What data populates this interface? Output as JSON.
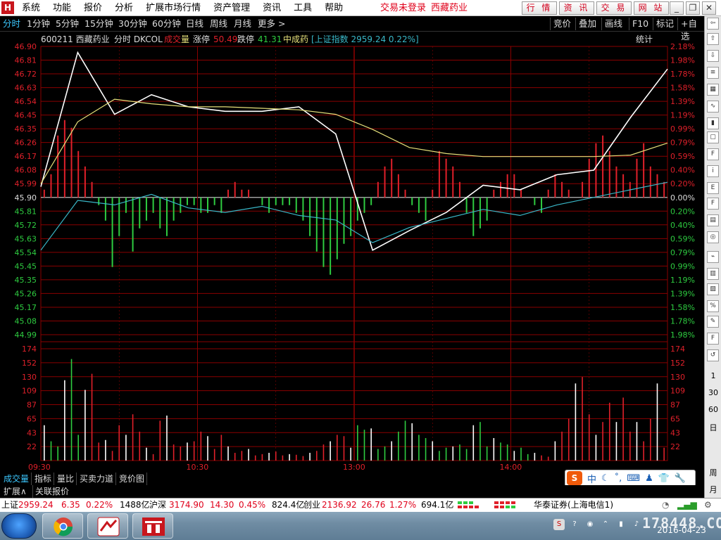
{
  "menu": {
    "items": [
      "系统",
      "功能",
      "报价",
      "分析",
      "扩展市场行情",
      "资产管理",
      "资讯",
      "工具",
      "帮助"
    ],
    "trade_status": "交易未登录",
    "stock_title": "西藏药业",
    "quick_buttons": [
      "行 情",
      "资 讯",
      "交 易",
      "网 站"
    ],
    "window_controls": [
      "_",
      "❐",
      "✕"
    ]
  },
  "tabs": {
    "periods": [
      "分时",
      "1分钟",
      "5分钟",
      "15分钟",
      "30分钟",
      "60分钟",
      "日线",
      "周线",
      "月线",
      "更多 >"
    ],
    "right": [
      "竞价",
      "叠加",
      "画线",
      "F10",
      "标记",
      "+自选"
    ]
  },
  "legend": {
    "code_name": "600211 西藏药业",
    "indicator": "分时 DKCOL",
    "vol_label_a": "成交",
    "vol_label_b": "量",
    "limit_up_label": "涨停",
    "limit_up": "50.49",
    "limit_down_label": "跌停",
    "limit_down": "41.31",
    "sector": "中成药",
    "index_info": "[上证指数 2959.24 0.22%]",
    "stats": "统计"
  },
  "colors": {
    "up": "#e0202a",
    "down": "#2ecc40",
    "price_line": "#ffffff",
    "avg_line": "#e6e07a",
    "index_line": "#39b8c8",
    "grid": "#8a0000"
  },
  "chart_data": [
    {
      "type": "line",
      "title": "分时",
      "x": [
        "09:30",
        "09:45",
        "10:00",
        "10:15",
        "10:30",
        "10:45",
        "11:00",
        "11:15",
        "11:30",
        "13:00",
        "13:15",
        "13:30",
        "13:45",
        "14:00",
        "14:15",
        "14:30",
        "14:45",
        "15:00"
      ],
      "xlabels": [
        "09:30",
        "10:30",
        "13:00",
        "14:00"
      ],
      "ylim": [
        44.99,
        46.9
      ],
      "yticks": [
        "46.90",
        "46.81",
        "46.72",
        "46.63",
        "46.54",
        "46.45",
        "46.35",
        "46.26",
        "46.17",
        "46.08",
        "45.99",
        "45.90",
        "45.81",
        "45.72",
        "45.63",
        "45.54",
        "45.45",
        "45.35",
        "45.26",
        "45.17",
        "45.08",
        "44.99"
      ],
      "pct_ticks": [
        "2.18%",
        "1.98%",
        "1.78%",
        "1.58%",
        "1.39%",
        "1.19%",
        "0.99%",
        "0.79%",
        "0.59%",
        "0.40%",
        "0.20%",
        "0.00%",
        "0.20%",
        "0.40%",
        "0.59%",
        "0.79%",
        "0.99%",
        "1.19%",
        "1.39%",
        "1.58%",
        "1.78%",
        "1.98%"
      ],
      "series": [
        {
          "name": "price",
          "values": [
            45.97,
            46.86,
            46.45,
            46.58,
            46.5,
            46.47,
            46.47,
            46.5,
            46.32,
            45.55,
            45.68,
            45.8,
            45.98,
            45.95,
            46.05,
            46.08,
            46.43,
            46.75
          ]
        },
        {
          "name": "average",
          "values": [
            45.99,
            46.4,
            46.55,
            46.52,
            46.5,
            46.5,
            46.49,
            46.48,
            46.45,
            46.35,
            46.23,
            46.19,
            46.17,
            46.17,
            46.17,
            46.17,
            46.18,
            46.26
          ]
        },
        {
          "name": "index",
          "values": [
            45.55,
            45.88,
            45.85,
            45.92,
            45.83,
            45.8,
            45.84,
            45.78,
            45.75,
            45.6,
            45.7,
            45.76,
            45.82,
            45.78,
            45.85,
            45.9,
            45.95,
            46.0
          ]
        }
      ]
    },
    {
      "type": "bar",
      "title": "成交量",
      "ylim": [
        0,
        174
      ],
      "yticks": [
        "174",
        "152",
        "130",
        "109",
        "87",
        "65",
        "43",
        "22"
      ],
      "values": [
        55,
        30,
        22,
        125,
        158,
        40,
        110,
        135,
        28,
        32,
        15,
        55,
        40,
        72,
        45,
        20,
        10,
        62,
        70,
        25,
        22,
        28,
        30,
        45,
        38,
        18,
        40,
        22,
        12,
        15,
        18,
        8,
        10,
        12,
        14,
        8,
        10,
        9,
        7,
        12,
        15,
        25,
        30,
        40,
        38,
        20,
        55,
        48,
        50,
        18,
        22,
        30,
        45,
        62,
        58,
        40,
        35,
        30,
        15,
        20,
        22,
        25,
        18,
        55,
        60,
        22,
        35,
        28,
        25,
        15,
        20,
        10,
        12,
        8,
        6,
        30,
        45,
        65,
        120,
        130,
        72,
        40,
        60,
        90,
        60,
        98,
        45,
        60,
        30,
        65,
        120,
        20
      ]
    },
    {
      "type": "bar",
      "title": "DKCOL",
      "ylim": [
        -1,
        1
      ],
      "values": [
        0.1,
        0.3,
        0.8,
        1.0,
        0.9,
        0.6,
        0.4,
        0.2,
        -0.1,
        -0.3,
        -0.9,
        -0.5,
        -0.2,
        -0.7,
        -0.4,
        -0.3,
        -0.2,
        -0.4,
        -0.5,
        -0.3,
        -0.2,
        -0.1,
        -0.1,
        -0.2,
        -0.2,
        -0.1,
        -0.2,
        0.1,
        0.2,
        0.1,
        0.1,
        0.0,
        -0.1,
        -0.2,
        -0.1,
        -0.1,
        -0.1,
        -0.2,
        -0.3,
        -0.5,
        -0.7,
        -0.9,
        -1.0,
        -0.8,
        -0.6,
        -0.5,
        -0.3,
        -0.2,
        -0.1,
        0.2,
        0.4,
        0.5,
        0.3,
        0.1,
        -0.1,
        -0.2,
        -0.3,
        0.1,
        0.6,
        0.5,
        0.4,
        0.2,
        -0.2,
        -0.5,
        -0.4,
        -0.3,
        0.1,
        0.2,
        0.3,
        0.3,
        0.1,
        0.0,
        -0.1,
        -0.2,
        0.1,
        0.3,
        0.2,
        0.1,
        0.0,
        0.2,
        0.5,
        0.7,
        0.8,
        0.6,
        0.4,
        0.3,
        0.2,
        0.5,
        0.7,
        0.4,
        0.3,
        0.2
      ]
    }
  ],
  "bottom_tabs": [
    "成交量",
    "指标",
    "量比",
    "买卖力道",
    "竞价图"
  ],
  "ext_items": [
    "扩展∧",
    "关联报价"
  ],
  "ime_items": [
    "中",
    "☾",
    "˚,",
    "⌨",
    "♟",
    "👕",
    "🔧"
  ],
  "right_toolbar_nums": [
    "1",
    "30",
    "60",
    "日",
    "周",
    "月"
  ],
  "status": {
    "sh_label": "上证",
    "sh_price": "2959.24",
    "sh_chg": "6.35",
    "sh_pct": "0.22%",
    "sh_amt": "1488亿",
    "hs_label": "沪深",
    "hs_price": "3174.90",
    "hs_chg": "14.30",
    "hs_pct": "0.45%",
    "hs_amt": "824.4亿",
    "cy_label": "创业",
    "cy_price": "2136.92",
    "cy_chg": "26.76",
    "cy_pct": "1.27%",
    "cy_amt": "694.1亿",
    "broker": "华泰证券(上海电信1)"
  },
  "taskbar": {
    "date": "2016-04-23",
    "watermark": "178448.COM"
  }
}
